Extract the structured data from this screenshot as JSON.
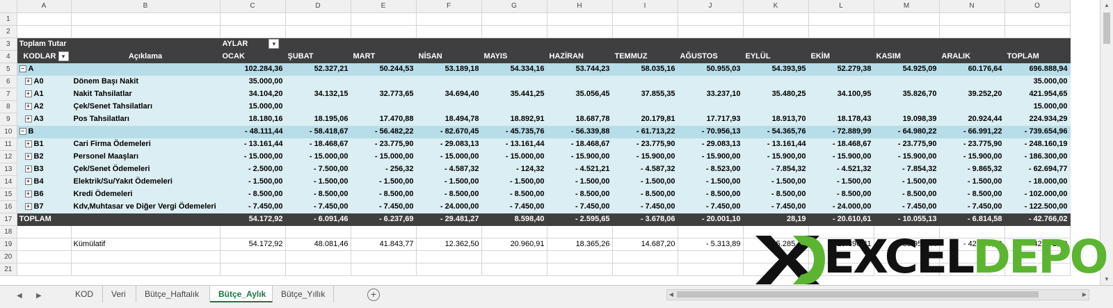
{
  "colors": {
    "header_bg": "#3f3f3f",
    "group_bg": "#b7dde8",
    "sub_bg": "#dbeef3",
    "active_tab": "#217346",
    "logo_green": "#5cb531"
  },
  "columns": [
    "A",
    "B",
    "C",
    "D",
    "E",
    "F",
    "G",
    "H",
    "I",
    "J",
    "K",
    "L",
    "M",
    "N",
    "O"
  ],
  "rownums": [
    "1",
    "2",
    "3",
    "4",
    "5",
    "6",
    "7",
    "8",
    "9",
    "10",
    "11",
    "12",
    "13",
    "14",
    "15",
    "16",
    "17",
    "18",
    "19",
    "20",
    "21"
  ],
  "pivot": {
    "value_label": "Toplam Tutar",
    "column_field": "AYLAR",
    "row_field": "KODLAR",
    "desc_header": "Açıklama",
    "months": [
      "OCAK",
      "ŞUBAT",
      "MART",
      "NİSAN",
      "MAYIS",
      "HAZİRAN",
      "TEMMUZ",
      "AĞUSTOS",
      "EYLÜL",
      "EKİM",
      "KASIM",
      "ARALIK",
      "TOPLAM"
    ],
    "rows": [
      {
        "code": "A",
        "desc": "",
        "values": [
          "102.284,36",
          "52.327,21",
          "50.244,53",
          "53.189,18",
          "54.334,16",
          "53.744,23",
          "58.035,16",
          "50.955,03",
          "54.393,95",
          "52.279,38",
          "54.925,09",
          "60.176,64",
          "696.888,94"
        ]
      },
      {
        "code": "A0",
        "desc": "Dönem Başı Nakit",
        "values": [
          "35.000,00",
          "",
          "",
          "",
          "",
          "",
          "",
          "",
          "",
          "",
          "",
          "",
          "35.000,00"
        ]
      },
      {
        "code": "A1",
        "desc": "Nakit Tahsilatlar",
        "values": [
          "34.104,20",
          "34.132,15",
          "32.773,65",
          "34.694,40",
          "35.441,25",
          "35.056,45",
          "37.855,35",
          "33.237,10",
          "35.480,25",
          "34.100,95",
          "35.826,70",
          "39.252,20",
          "421.954,65"
        ]
      },
      {
        "code": "A2",
        "desc": "Çek/Senet Tahsilatları",
        "values": [
          "15.000,00",
          "",
          "",
          "",
          "",
          "",
          "",
          "",
          "",
          "",
          "",
          "",
          "15.000,00"
        ]
      },
      {
        "code": "A3",
        "desc": "Pos Tahsilatları",
        "values": [
          "18.180,16",
          "18.195,06",
          "17.470,88",
          "18.494,78",
          "18.892,91",
          "18.687,78",
          "20.179,81",
          "17.717,93",
          "18.913,70",
          "18.178,43",
          "19.098,39",
          "20.924,44",
          "224.934,29"
        ]
      },
      {
        "code": "B",
        "desc": "",
        "values": [
          "-  48.111,44",
          "-  58.418,67",
          "-  56.482,22",
          "-  82.670,45",
          "-  45.735,76",
          "-  56.339,88",
          "-  61.713,22",
          "-  70.956,13",
          "-  54.365,76",
          "-  72.889,99",
          "-  64.980,22",
          "-  66.991,22",
          "- 739.654,96"
        ]
      },
      {
        "code": "B1",
        "desc": "Cari Firma Ödemeleri",
        "values": [
          "-  13.161,44",
          "-  18.468,67",
          "-  23.775,90",
          "-  29.083,13",
          "-  13.161,44",
          "-  18.468,67",
          "-  23.775,90",
          "-  29.083,13",
          "-  13.161,44",
          "-  18.468,67",
          "-  23.775,90",
          "-  23.775,90",
          "- 248.160,19"
        ]
      },
      {
        "code": "B2",
        "desc": "Personel Maaşları",
        "values": [
          "-  15.000,00",
          "-  15.000,00",
          "-  15.000,00",
          "-  15.000,00",
          "-  15.000,00",
          "-  15.900,00",
          "-  15.900,00",
          "-  15.900,00",
          "-  15.900,00",
          "-  15.900,00",
          "-  15.900,00",
          "-  15.900,00",
          "- 186.300,00"
        ]
      },
      {
        "code": "B3",
        "desc": "Çek/Senet Ödemeleri",
        "values": [
          "-   2.500,00",
          "-   7.500,00",
          "-      256,32",
          "-   4.587,32",
          "-      124,32",
          "-   4.521,21",
          "-   4.587,32",
          "-   8.523,00",
          "-   7.854,32",
          "-   4.521,32",
          "-   7.854,32",
          "-   9.865,32",
          "-  62.694,77"
        ]
      },
      {
        "code": "B4",
        "desc": "Elektrik/Su/Yakıt Ödemeleri",
        "values": [
          "-   1.500,00",
          "-   1.500,00",
          "-   1.500,00",
          "-   1.500,00",
          "-   1.500,00",
          "-   1.500,00",
          "-   1.500,00",
          "-   1.500,00",
          "-   1.500,00",
          "-   1.500,00",
          "-   1.500,00",
          "-   1.500,00",
          "-  18.000,00"
        ]
      },
      {
        "code": "B6",
        "desc": "Kredi Ödemeleri",
        "values": [
          "-   8.500,00",
          "-   8.500,00",
          "-   8.500,00",
          "-   8.500,00",
          "-   8.500,00",
          "-   8.500,00",
          "-   8.500,00",
          "-   8.500,00",
          "-   8.500,00",
          "-   8.500,00",
          "-   8.500,00",
          "-   8.500,00",
          "- 102.000,00"
        ]
      },
      {
        "code": "B7",
        "desc": "Kdv,Muhtasar ve Diğer Vergi Ödemeleri",
        "values": [
          "-   7.450,00",
          "-   7.450,00",
          "-   7.450,00",
          "-  24.000,00",
          "-   7.450,00",
          "-   7.450,00",
          "-   7.450,00",
          "-   7.450,00",
          "-   7.450,00",
          "-  24.000,00",
          "-   7.450,00",
          "-   7.450,00",
          "- 122.500,00"
        ]
      }
    ],
    "total": {
      "label": "TOPLAM",
      "values": [
        "54.172,92",
        "-   6.091,46",
        "-   6.237,69",
        "-  29.481,27",
        "8.598,40",
        "-   2.595,65",
        "-   3.678,06",
        "-  20.001,10",
        "28,19",
        "-  20.610,61",
        "-  10.055,13",
        "-   6.814,58",
        "-  42.766,02"
      ]
    }
  },
  "cumulative": {
    "label": "Kümülatif",
    "values": [
      "54.172,92",
      "48.081,46",
      "41.843,77",
      "12.362,50",
      "20.960,91",
      "18.365,26",
      "14.687,20",
      "-  5.313,89",
      "-   5.285,70",
      "-  25.896,31",
      "-  35.951,44",
      "-  42.766,02",
      "42.772,60"
    ]
  },
  "tabs": {
    "items": [
      "KOD",
      "Veri",
      "Bütçe_Haftalık",
      "Bütçe_Aylık",
      "Bütçe_Yıllık"
    ],
    "active": "Bütçe_Aylık"
  },
  "logo": {
    "x": "X",
    "text1": "EXCEL",
    "text2": "DEPO"
  }
}
